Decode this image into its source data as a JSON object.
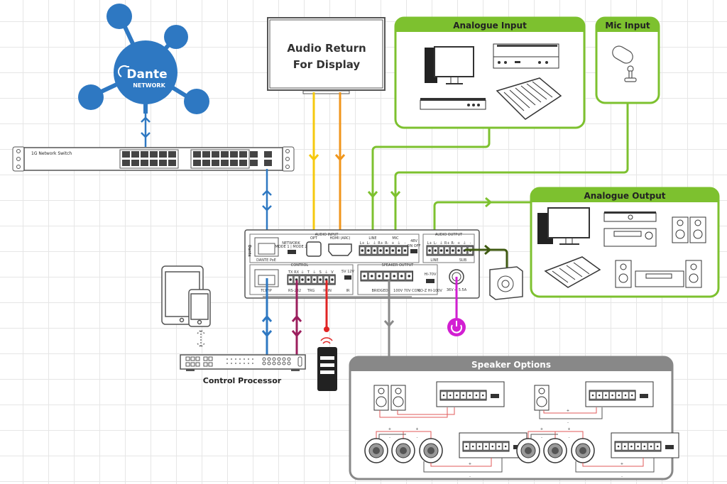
{
  "dante": {
    "brand": "Dante",
    "subtitle": "NETWORK",
    "color": "#2e78c2"
  },
  "switch": {
    "label": "1G Network Switch"
  },
  "display": {
    "line1": "Audio Return",
    "line2": "For Display"
  },
  "groups": {
    "analogue_input": {
      "title": "Analogue Input",
      "color": "#7dc12f"
    },
    "mic_input": {
      "title": "Mic Input",
      "color": "#7dc12f"
    },
    "analogue_output": {
      "title": "Analogue Output",
      "color": "#7dc12f"
    },
    "speaker_options": {
      "title": "Speaker Options",
      "color": "#808080"
    }
  },
  "control_processor": {
    "label": "Control Processor"
  },
  "device": {
    "brand": "Dante",
    "sections": {
      "audio_input": "AUDIO INPUT",
      "audio_output": "AUDIO OUTPUT",
      "control": "CONTROL",
      "speaker_output": "SPEAKER OUTPUT"
    },
    "ports": {
      "dante_poe": "DANTE PoE",
      "network": "NETWORK",
      "network_mode": "MODE 1 | MODE 2",
      "opt": "OPT",
      "hdmi": "HDMI (ARC)",
      "line": "LINE",
      "mic": "MIC",
      "phantom": "48V",
      "phantom_state": "ON OFF",
      "out_line": "LINE",
      "sub": "SUB",
      "tcpip": "TCP/IP",
      "rs232": "RS-232",
      "trg": "TRG",
      "irin": "IR IN",
      "ir": "IR",
      "ir_switch": "5V 12V",
      "bridged": "BRIDGED",
      "speaker_modes": "100V 70V COM",
      "hiz": "HI-70V",
      "loz": "LO-Z  HI-100V",
      "power": "36V ⎓ 5.5A"
    },
    "in_pins": [
      "L+",
      "L-",
      "⏚",
      "R+",
      "R-",
      "+",
      "⏚",
      "-"
    ],
    "out_pins": [
      "L+",
      "L-",
      "⏚",
      "R+",
      "R-",
      "+",
      "⏚",
      "-"
    ],
    "control_pins": [
      "TX",
      "RX",
      "⏚",
      "T",
      "⏚",
      "S",
      "⏚",
      "V"
    ]
  },
  "wire_colors": {
    "network": "#2e78c2",
    "optical": "#f6c90e",
    "hdmi": "#f0961c",
    "analogue": "#7dc12f",
    "sub": "#3f5a12",
    "rs232": "#9c1f5e",
    "ir": "#e02424",
    "power": "#d21fd2",
    "speaker": "#8a8a8a",
    "speaker_pos": "#e05a5a"
  },
  "speaker_polarity": {
    "plus": "+",
    "minus": "-"
  }
}
